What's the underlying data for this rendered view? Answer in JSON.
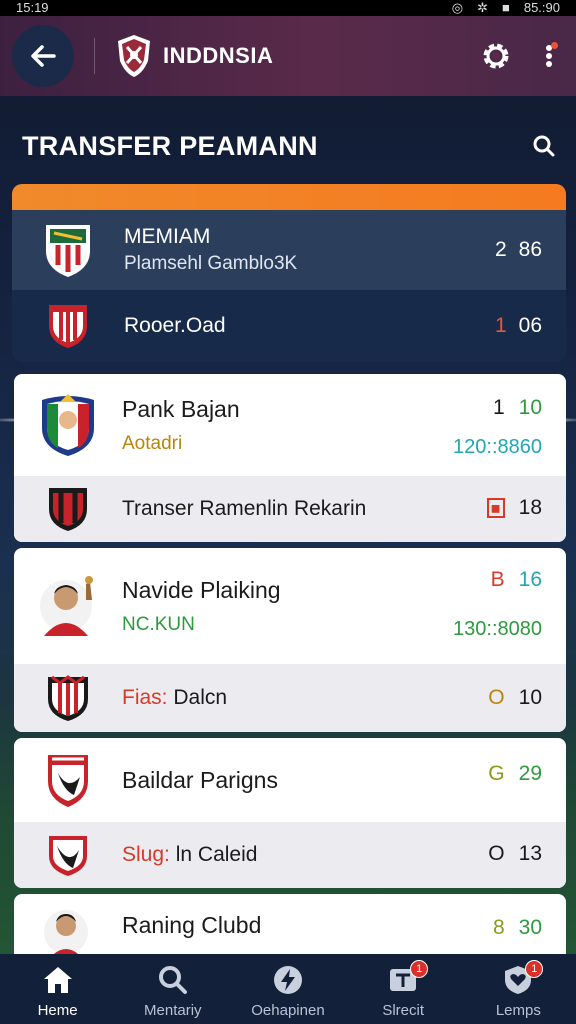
{
  "status_bar": {
    "time": "15:19",
    "right": "85.:90"
  },
  "app_bar": {
    "title": "INDDNSIA"
  },
  "page": {
    "title": "TRANSFER PEAMANN"
  },
  "featured": [
    {
      "name": "MEMIAM",
      "sub": "Plamsehl Gamblo3K",
      "score_a": "2",
      "score_b": "86",
      "score_a_color": "#ffffff",
      "score_b_color": "#ffffff"
    },
    {
      "name": "Rooer.Oad",
      "sub": "",
      "score_a": "1",
      "score_b": "06",
      "score_a_color": "#e8553a",
      "score_b_color": "#ffffff"
    }
  ],
  "cards": [
    {
      "rows": [
        {
          "name": "Pank Bajan",
          "sub": "Aotadri",
          "sub_color": "#b8860b",
          "score_a": "1",
          "score_b": "10",
          "score_a_color": "#1a1a1a",
          "score_b_color": "#2e9a3e",
          "meta": "120::8860",
          "meta_color": "#21a7b4"
        },
        {
          "name": "Transer Ramenlin Rekarin",
          "sub": "",
          "score_a": "",
          "score_b": "18",
          "score_b_color": "#1a1a1a",
          "boxed": true
        }
      ]
    },
    {
      "rows": [
        {
          "name": "Navide Plaiking",
          "sub": "NC.KUN",
          "sub_color": "#2e9a3e",
          "score_a": "B",
          "score_b": "16",
          "score_a_color": "#d83a2a",
          "score_b_color": "#21a7b4",
          "meta": "130::8080",
          "meta_color": "#2e9a3e"
        },
        {
          "name_prefix": "Fias:",
          "name": "Dalcn",
          "prefix_color": "#d83a2a",
          "score_a": "O",
          "score_b": "10",
          "score_a_color": "#b8860b",
          "score_b_color": "#1a1a1a"
        }
      ]
    },
    {
      "rows": [
        {
          "name": "Baildar Parigns",
          "score_a": "G",
          "score_b": "29",
          "score_a_color": "#8a9a1a",
          "score_b_color": "#2e9a3e"
        },
        {
          "name_prefix": "Slug:",
          "name": "ln Caleid",
          "prefix_color": "#d83a2a",
          "score_a": "O",
          "score_b": "13",
          "score_a_color": "#1a1a1a",
          "score_b_color": "#1a1a1a"
        }
      ]
    },
    {
      "rows": [
        {
          "name": "Raning Clubd",
          "score_a": "8",
          "score_b": "30",
          "score_a_color": "#8a9a1a",
          "score_b_color": "#2e9a3e"
        }
      ]
    }
  ],
  "bottom_nav": [
    {
      "label": "Heme",
      "icon": "home-icon",
      "active": true
    },
    {
      "label": "Mentariy",
      "icon": "search-icon"
    },
    {
      "label": "Oehapinen",
      "icon": "bolt-icon"
    },
    {
      "label": "Slrecit",
      "icon": "notice-icon",
      "badge": "1"
    },
    {
      "label": "Lemps",
      "icon": "shield-heart-icon",
      "badge": "1"
    }
  ],
  "colors": {
    "accent": "#f08a2a",
    "app_bar": "#4a2848",
    "nav_bg": "#13203a"
  }
}
